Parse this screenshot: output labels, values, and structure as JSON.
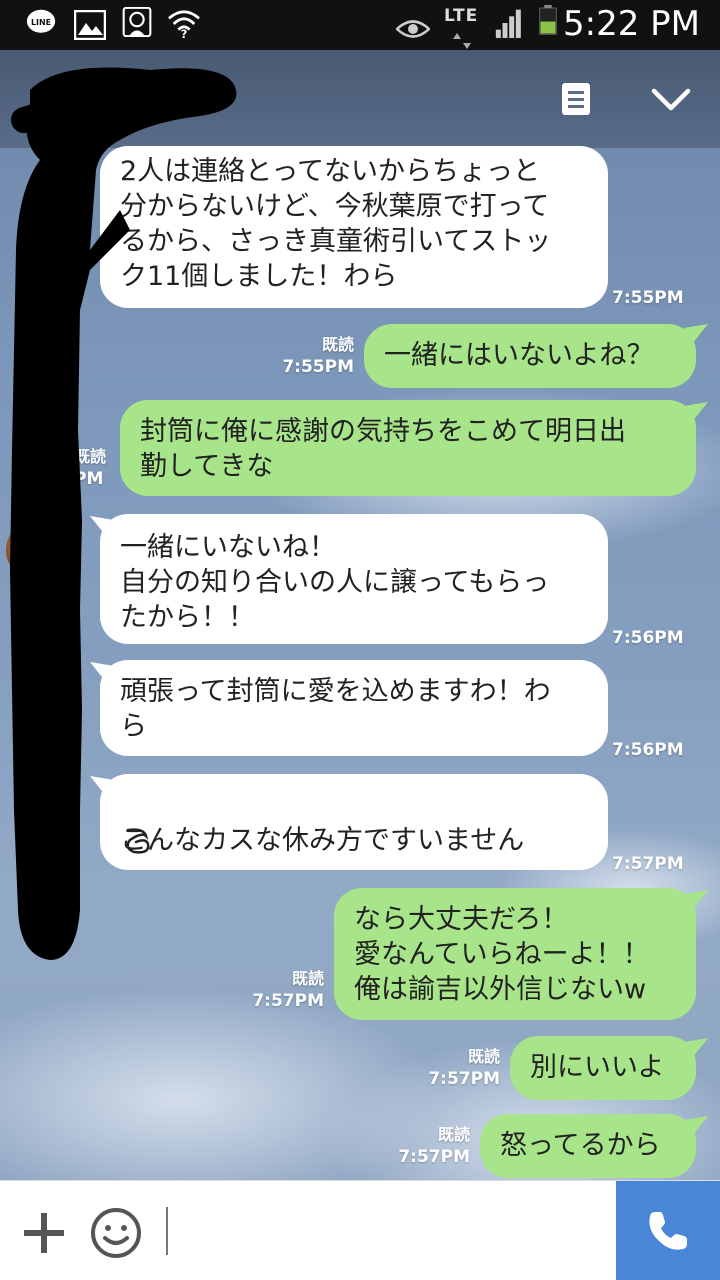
{
  "status_bar": {
    "time": "5:22 PM",
    "network": "LTE",
    "icons": [
      "line-app-icon",
      "gallery-icon",
      "app-notification-icon",
      "wifi-question-icon",
      "eye-icon",
      "signal-icon",
      "battery-icon"
    ]
  },
  "header": {
    "menu_icon": "document-icon",
    "collapse_icon": "chevron-down-icon"
  },
  "messages": [
    {
      "side": "in",
      "text": "2人は連絡とってないからちょっと\n分からないけど、今秋葉原で打って\nるから、さっき真童術引いてストッ\nク11個しました！わら",
      "time": "7:55PM"
    },
    {
      "side": "out",
      "text": "一緒にはいないよね？",
      "read": "既読",
      "time": "7:55PM"
    },
    {
      "side": "out",
      "text": "封筒に俺に感謝の気持ちをこめて明日出\n勤してきな",
      "read": "既読",
      "time": "PM"
    },
    {
      "side": "in",
      "text": "一緒にいないね！\n自分の知り合いの人に譲ってもらっ\nたから！！",
      "time": "7:56PM"
    },
    {
      "side": "in",
      "text": "頑張って封筒に愛を込めますわ！わ\nら",
      "time": "7:56PM"
    },
    {
      "side": "in",
      "text": "こんなカスな休み方ですいません",
      "time": "7:57PM"
    },
    {
      "side": "out",
      "text": "なら大丈夫だろ！\n愛なんていらねーよ！！\n俺は諭吉以外信じないw",
      "read": "既読",
      "time": "7:57PM"
    },
    {
      "side": "out",
      "text": "別にいいよ",
      "read": "既読",
      "time": "7:57PM"
    },
    {
      "side": "out",
      "text": "怒ってるから",
      "read": "既読",
      "time": "7:57PM"
    }
  ],
  "input_bar": {
    "add_icon": "plus-icon",
    "emoji_icon": "smiley-icon",
    "call_icon": "phone-icon"
  },
  "colors": {
    "incoming_bubble": "#ffffff",
    "outgoing_bubble": "#a8e58a",
    "call_button": "#4a86d8",
    "status_bar": "#111111"
  }
}
